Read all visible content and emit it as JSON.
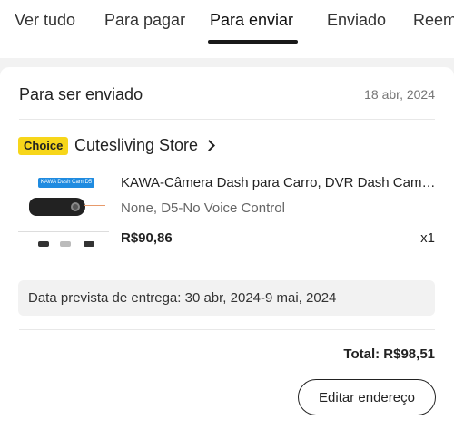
{
  "tabs": [
    {
      "label": "Ver tudo"
    },
    {
      "label": "Para pagar"
    },
    {
      "label": "Para enviar",
      "active": true
    },
    {
      "label": "Enviado"
    },
    {
      "label": "Reem"
    }
  ],
  "order": {
    "status_title": "Para ser enviado",
    "date": "18 abr, 2024",
    "badge": "Choice",
    "store_name": "Cutesliving Store",
    "product": {
      "image_banner": "KAWA Dash Cam D5",
      "title": "KAWA-Câmera Dash para Carro, DVR Dash Cam com controle de voz",
      "variant": "None, D5-No Voice Control",
      "price": "R$90,86",
      "quantity": "x1"
    },
    "delivery_estimate": "Data prevista de entrega: 30 abr, 2024-9 mai, 2024",
    "total": "Total: R$98,51",
    "edit_address_label": "Editar endereço"
  },
  "colors": {
    "choice_badge": "#f7d61a",
    "active_tab_underline": "#191919",
    "page_background": "#f2f2f2"
  }
}
